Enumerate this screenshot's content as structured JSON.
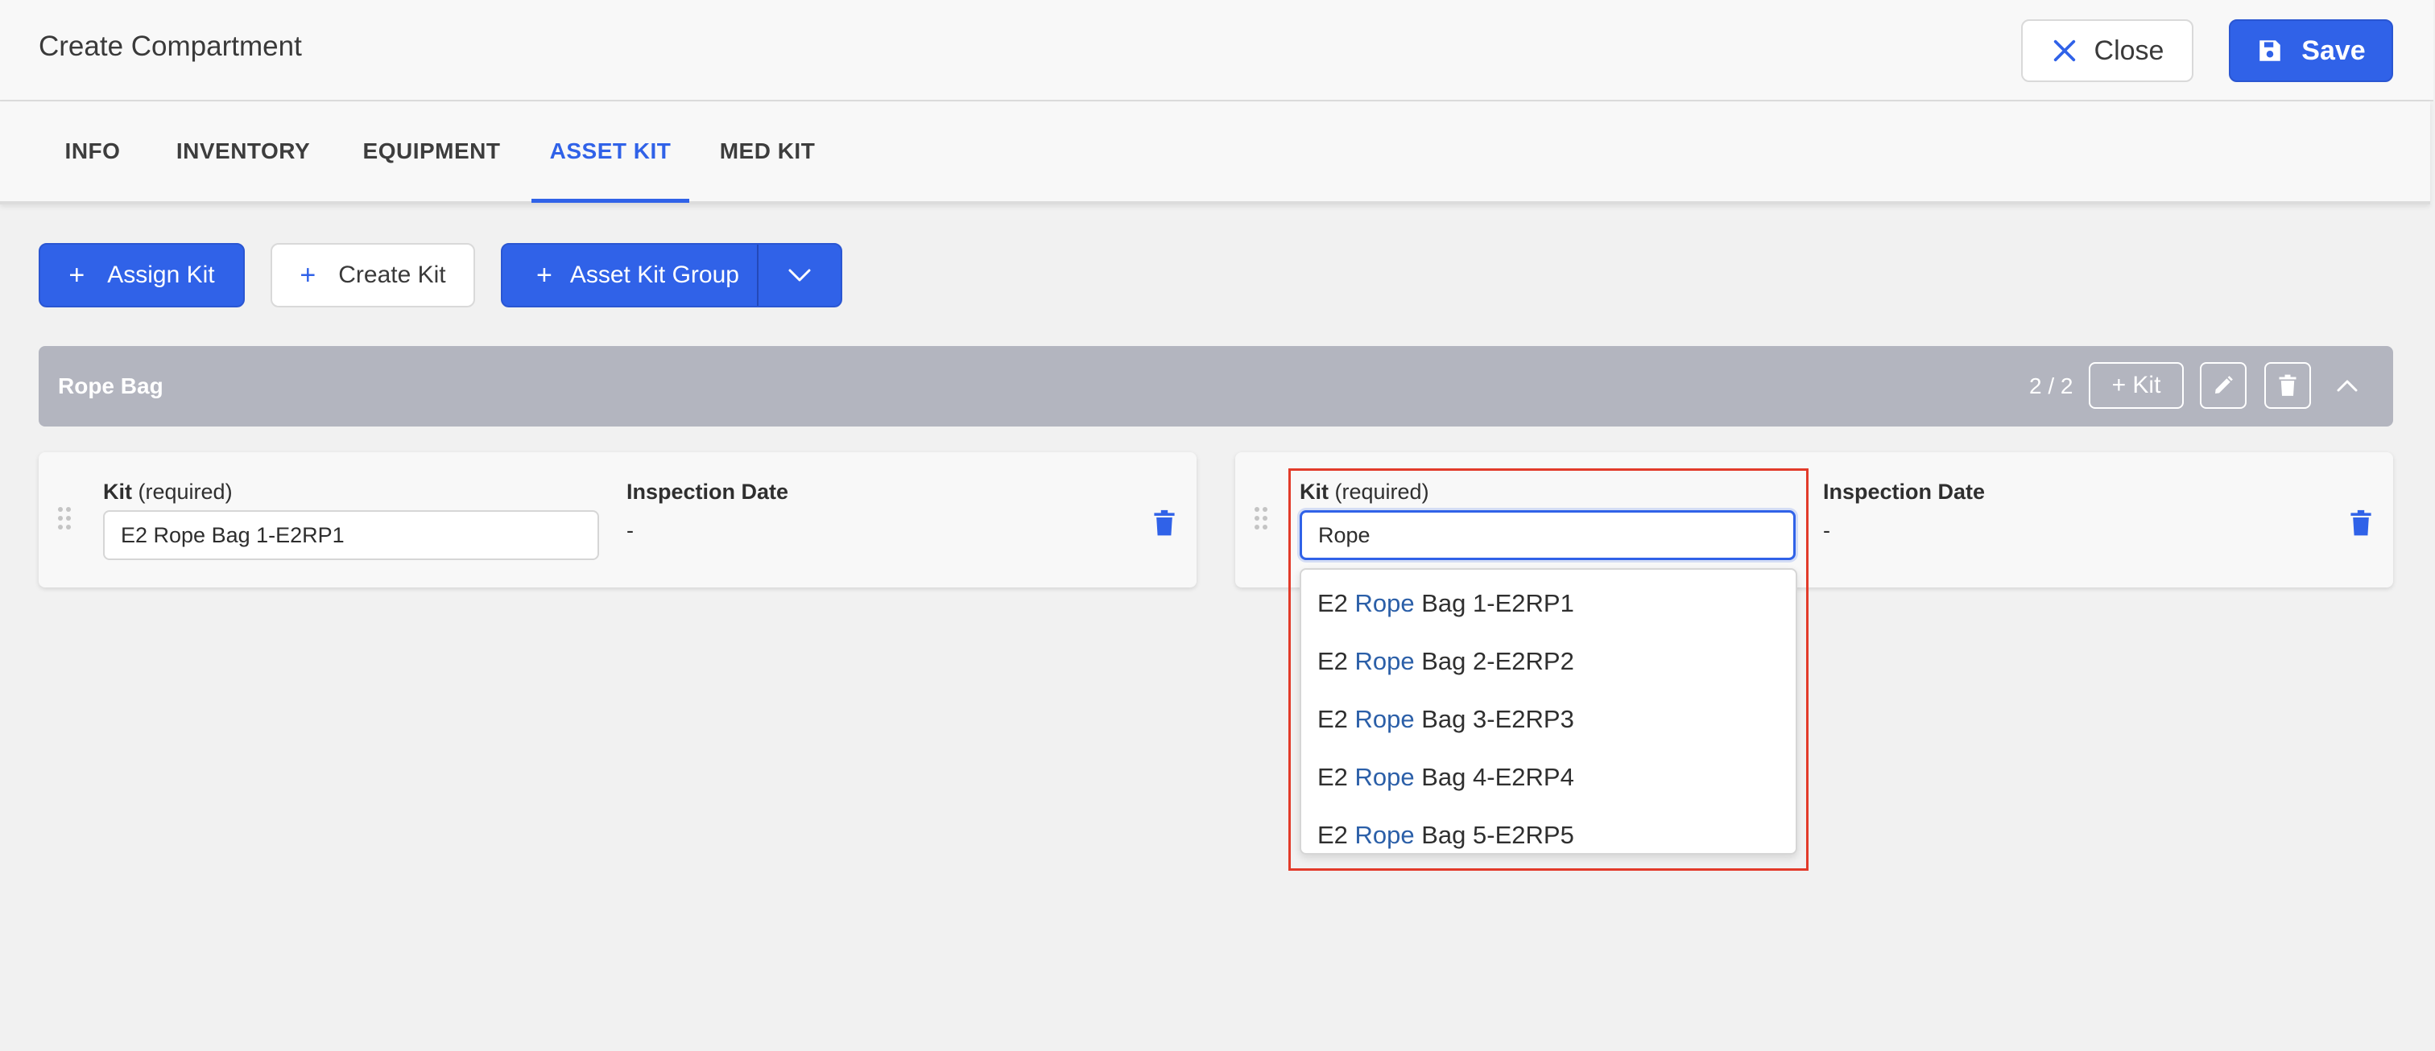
{
  "header": {
    "title": "Create Compartment",
    "close_label": "Close",
    "save_label": "Save"
  },
  "tabs": [
    {
      "label": "INFO"
    },
    {
      "label": "INVENTORY"
    },
    {
      "label": "EQUIPMENT"
    },
    {
      "label": "ASSET KIT",
      "active": true
    },
    {
      "label": "MED KIT"
    }
  ],
  "actions": {
    "assign_kit": "Assign Kit",
    "create_kit": "Create Kit",
    "asset_kit_group": "Asset Kit Group"
  },
  "group": {
    "title": "Rope Bag",
    "count": "2 / 2",
    "add_kit_label": "+ Kit"
  },
  "kits": [
    {
      "kit_label": "Kit",
      "kit_required": "(required)",
      "kit_value": "E2 Rope Bag 1-E2RP1",
      "date_label": "Inspection Date",
      "date_value": "-"
    },
    {
      "kit_label": "Kit",
      "kit_required": "(required)",
      "kit_value": "Rope",
      "date_label": "Inspection Date",
      "date_value": "-"
    }
  ],
  "dropdown": {
    "options": [
      {
        "prefix": "E2 ",
        "match": "Rope",
        "suffix": " Bag 1-E2RP1"
      },
      {
        "prefix": "E2 ",
        "match": "Rope",
        "suffix": " Bag 2-E2RP2"
      },
      {
        "prefix": "E2 ",
        "match": "Rope",
        "suffix": " Bag 3-E2RP3"
      },
      {
        "prefix": "E2 ",
        "match": "Rope",
        "suffix": " Bag 4-E2RP4"
      },
      {
        "prefix": "E2 ",
        "match": "Rope",
        "suffix": " Bag 5-E2RP5"
      }
    ]
  },
  "colors": {
    "primary": "#3062e8",
    "group_bar": "#b3b5bf",
    "highlight": "#e23b2a",
    "match_text": "#2b5fa8"
  }
}
